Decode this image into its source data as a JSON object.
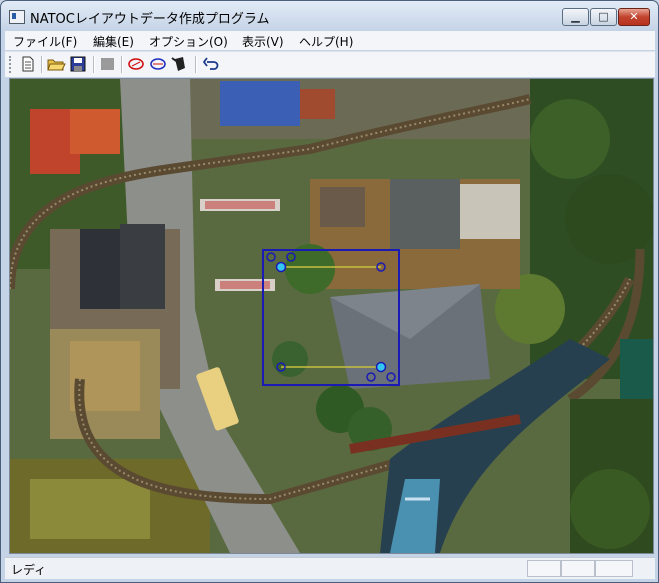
{
  "window": {
    "title": "NATOCレイアウトデータ作成プログラム"
  },
  "title_buttons": {
    "minimize": "▁",
    "maximize": "□",
    "close": "✕"
  },
  "menu": [
    {
      "label": "ファイル(F)"
    },
    {
      "label": "編集(E)"
    },
    {
      "label": "オプション(O)"
    },
    {
      "label": "表示(V)"
    },
    {
      "label": "ヘルプ(H)"
    }
  ],
  "toolbar_icons": [
    "new-file-icon",
    "open-folder-icon",
    "save-icon",
    "stop-icon",
    "red-ellipse-icon",
    "blue-ellipse-icon",
    "bucket-icon",
    "undo-icon"
  ],
  "colors": {
    "selection": "#1a1ab4",
    "handle_fill": "#34c8f0",
    "connector_line": "#c8c040"
  },
  "statusbar": {
    "text": "レディ"
  }
}
